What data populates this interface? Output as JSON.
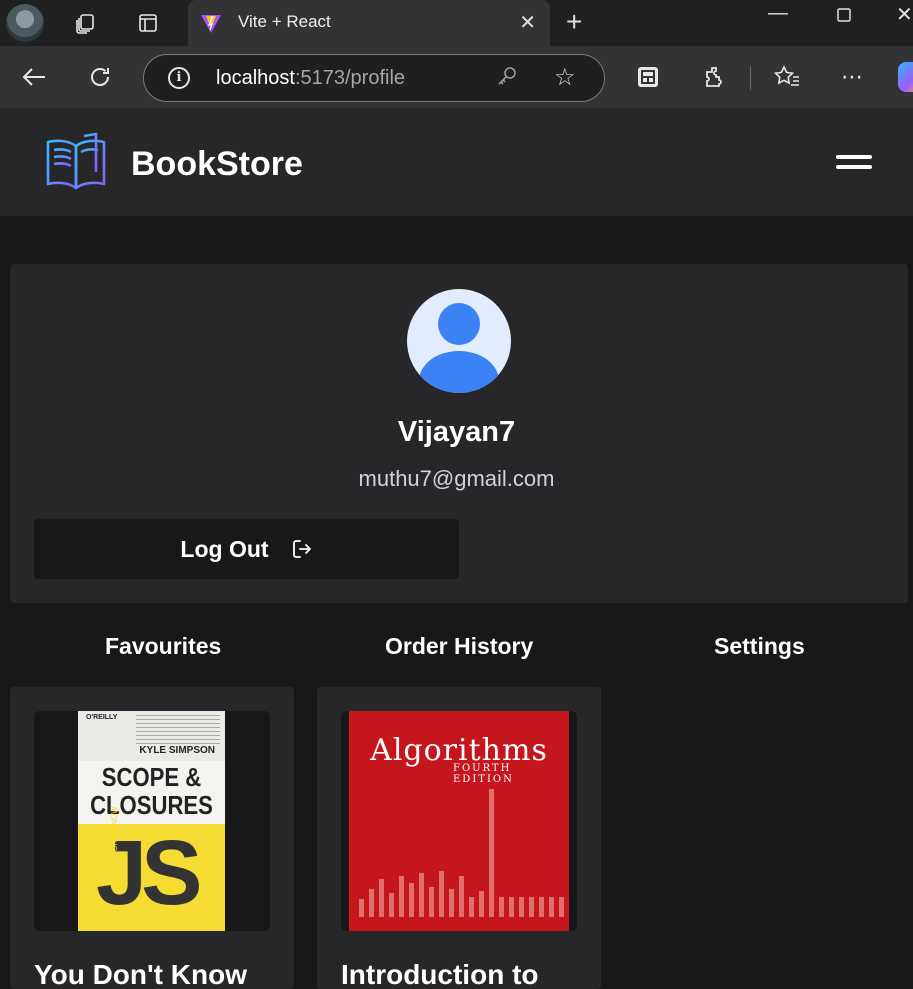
{
  "browser": {
    "tab_title": "Vite + React",
    "url_host": "localhost",
    "url_path": ":5173/profile"
  },
  "app": {
    "brand": "BookStore"
  },
  "profile": {
    "username": "Vijayan7",
    "email": "muthu7@gmail.com",
    "logout_label": "Log Out"
  },
  "tabs": [
    "Favourites",
    "Order History",
    "Settings"
  ],
  "books": [
    {
      "title": "You Don't Know",
      "cover": {
        "publisher": "O'REILLY",
        "author": "KYLE SIMPSON",
        "line1": "SCOPE &",
        "line2": "CLOSURES",
        "badge": "JS",
        "series": "YOU DON'T KNOW"
      }
    },
    {
      "title": "Introduction to",
      "cover": {
        "title": "Algorithms",
        "edition": "FOURTH EDITION"
      }
    }
  ],
  "colors": {
    "page_bg": "#18181b",
    "card_bg": "#27272a",
    "avatar_accent": "#3b82f6"
  }
}
